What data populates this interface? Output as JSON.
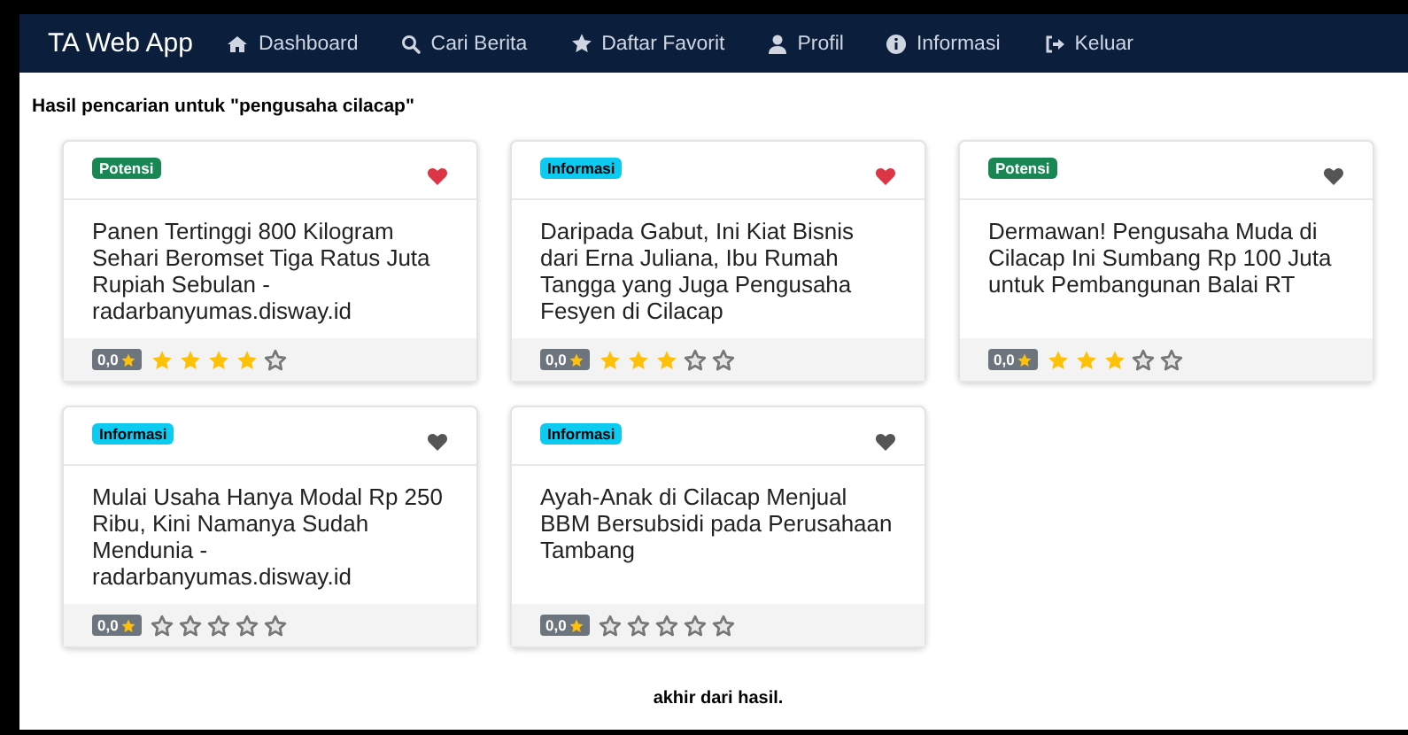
{
  "navbar": {
    "brand": "TA Web App",
    "items": [
      {
        "label": "Dashboard",
        "kind": "home"
      },
      {
        "label": "Cari Berita",
        "kind": "search"
      },
      {
        "label": "Daftar Favorit",
        "kind": "star"
      },
      {
        "label": "Profil",
        "kind": "user"
      },
      {
        "label": "Informasi",
        "kind": "info"
      },
      {
        "label": "Keluar",
        "kind": "logout"
      }
    ]
  },
  "heading": "Hasil pencarian untuk \"pengusaha cilacap\"",
  "cards": [
    {
      "category": "Potensi",
      "kind": "potensi",
      "favorite": true,
      "title": "Panen Tertinggi 800 Kilogram Sehari Beromset Tiga Ratus Juta Rupiah Sebulan - radarbanyumas.disway.id",
      "rating": "0,0",
      "stars": 4
    },
    {
      "category": "Informasi",
      "kind": "informasi",
      "favorite": true,
      "title": "Daripada Gabut, Ini Kiat Bisnis dari Erna Juliana, Ibu Rumah Tangga yang Juga Pengusaha Fesyen di Cilacap",
      "rating": "0,0",
      "stars": 3
    },
    {
      "category": "Potensi",
      "kind": "potensi",
      "favorite": false,
      "title": "Dermawan! Pengusaha Muda di Cilacap Ini Sumbang Rp 100 Juta untuk Pembangunan Balai RT",
      "rating": "0,0",
      "stars": 3
    },
    {
      "category": "Informasi",
      "kind": "informasi",
      "favorite": false,
      "title": "Mulai Usaha Hanya Modal Rp 250 Ribu, Kini Namanya Sudah Mendunia - radarbanyumas.disway.id",
      "rating": "0,0",
      "stars": 0
    },
    {
      "category": "Informasi",
      "kind": "informasi",
      "favorite": false,
      "title": "Ayah-Anak di Cilacap Menjual BBM Bersubsidi pada Perusahaan Tambang",
      "rating": "0,0",
      "stars": 0
    }
  ],
  "footer": "akhir dari hasil."
}
